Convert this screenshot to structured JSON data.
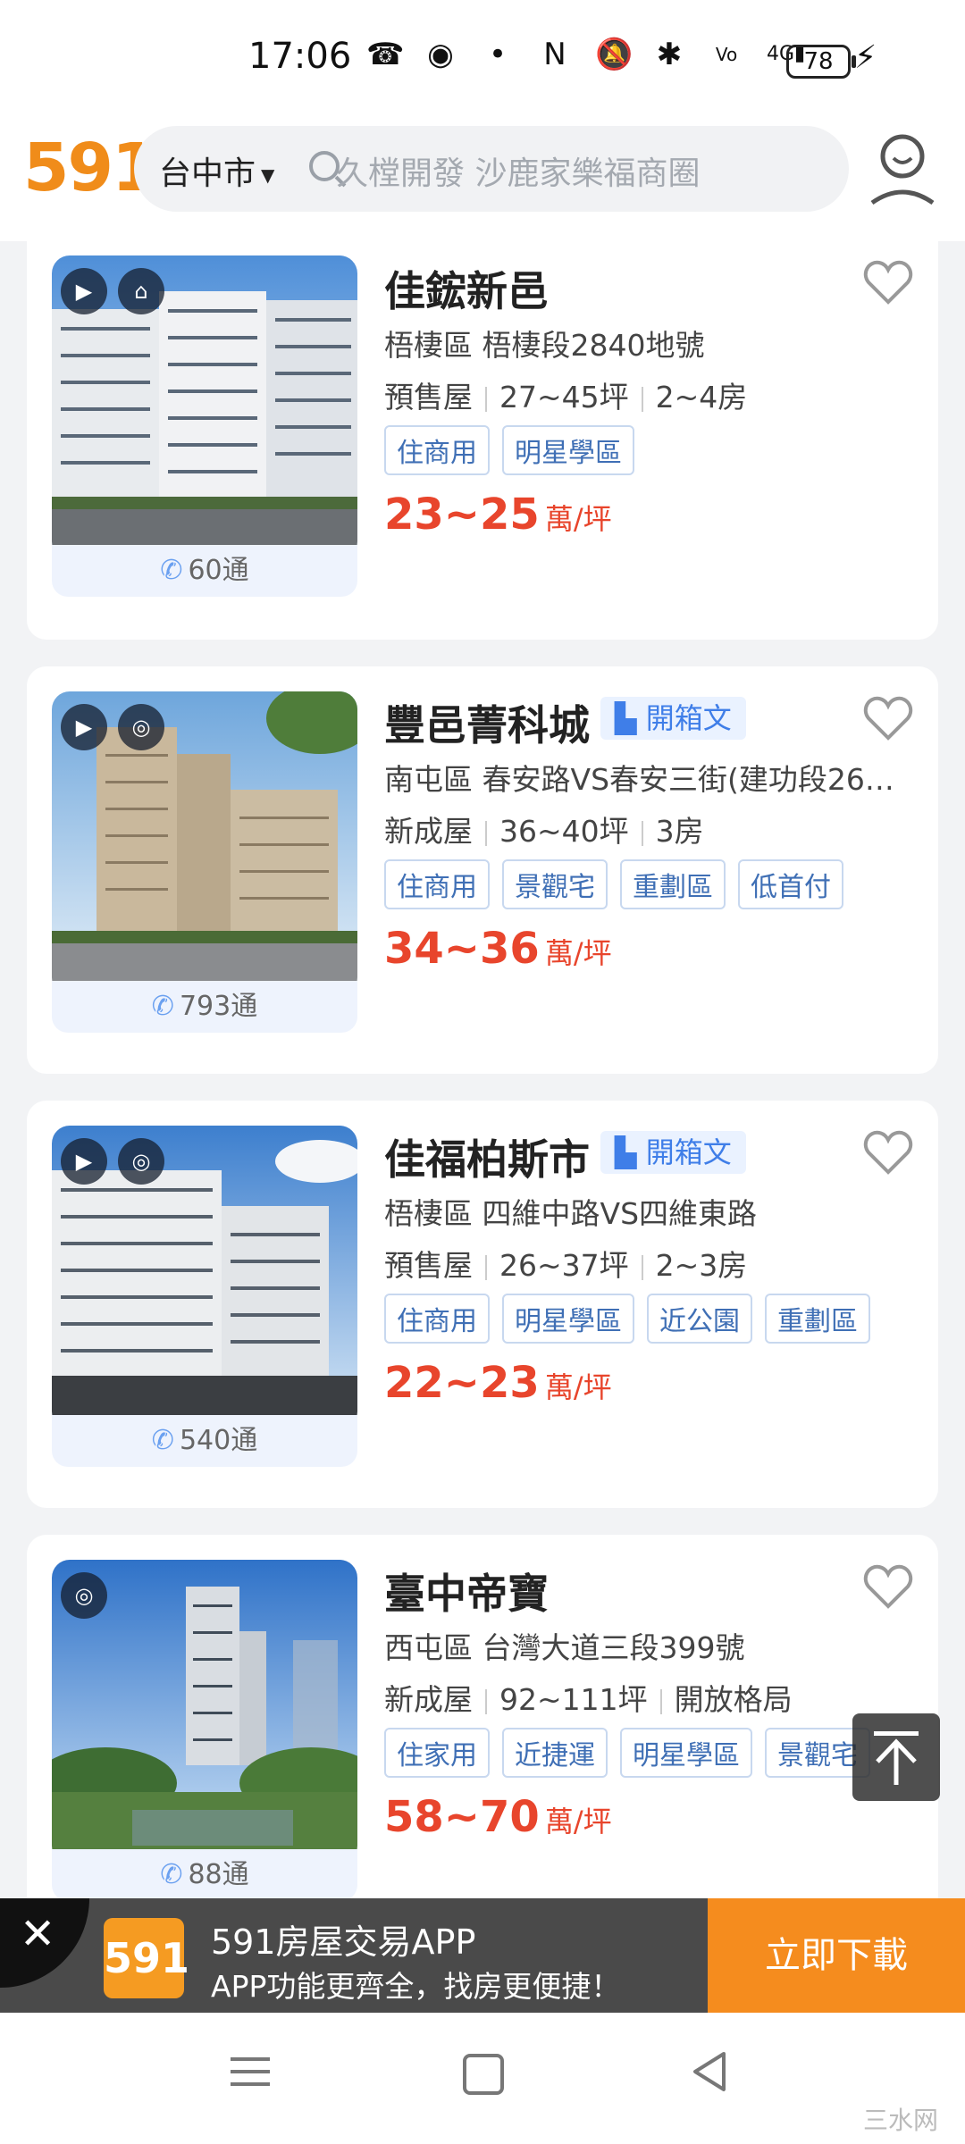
{
  "status_bar": {
    "time": "17:06",
    "battery": "78",
    "icons": [
      "missed-call-icon",
      "messenger-icon",
      "dot-icon",
      "nfc-icon",
      "mute-icon",
      "bluetooth-icon",
      "volte-icon",
      "signal-4g-icon",
      "charging-icon"
    ]
  },
  "header": {
    "logo": "591",
    "city": "台中市",
    "search_placeholder": "久樘開發 沙鹿家樂福商圈"
  },
  "listings": [
    {
      "title": "佳鋐新邑",
      "has_kaixiang": false,
      "address": "梧棲區 梧棲段2840地號",
      "type": "預售屋",
      "size": "27~45坪",
      "rooms": "2~4房",
      "tags": [
        "住商用",
        "明星學區"
      ],
      "price": "23~25",
      "price_unit": "萬/坪",
      "calls": "60通"
    },
    {
      "title": "豐邑菁科城",
      "has_kaixiang": true,
      "address": "南屯區 春安路VS春安三街(建功段26…",
      "type": "新成屋",
      "size": "36~40坪",
      "rooms": "3房",
      "tags": [
        "住商用",
        "景觀宅",
        "重劃區",
        "低首付"
      ],
      "price": "34~36",
      "price_unit": "萬/坪",
      "calls": "793通"
    },
    {
      "title": "佳福柏斯市",
      "has_kaixiang": true,
      "address": "梧棲區 四維中路VS四維東路",
      "type": "預售屋",
      "size": "26~37坪",
      "rooms": "2~3房",
      "tags": [
        "住商用",
        "明星學區",
        "近公園",
        "重劃區"
      ],
      "price": "22~23",
      "price_unit": "萬/坪",
      "calls": "540通"
    },
    {
      "title": "臺中帝寶",
      "has_kaixiang": false,
      "address": "西屯區 台灣大道三段399號",
      "type": "新成屋",
      "size": "92~111坪",
      "rooms": "開放格局",
      "tags": [
        "住家用",
        "近捷運",
        "明星學區",
        "景觀宅"
      ],
      "price": "58~70",
      "price_unit": "萬/坪",
      "calls": "88通"
    }
  ],
  "kaixiang_label": "開箱文",
  "banner": {
    "logo": "591",
    "title": "591房屋交易APP",
    "subtitle": "APP功能更齊全，找房更便捷！",
    "button": "立即下載"
  },
  "watermark": "三水网"
}
